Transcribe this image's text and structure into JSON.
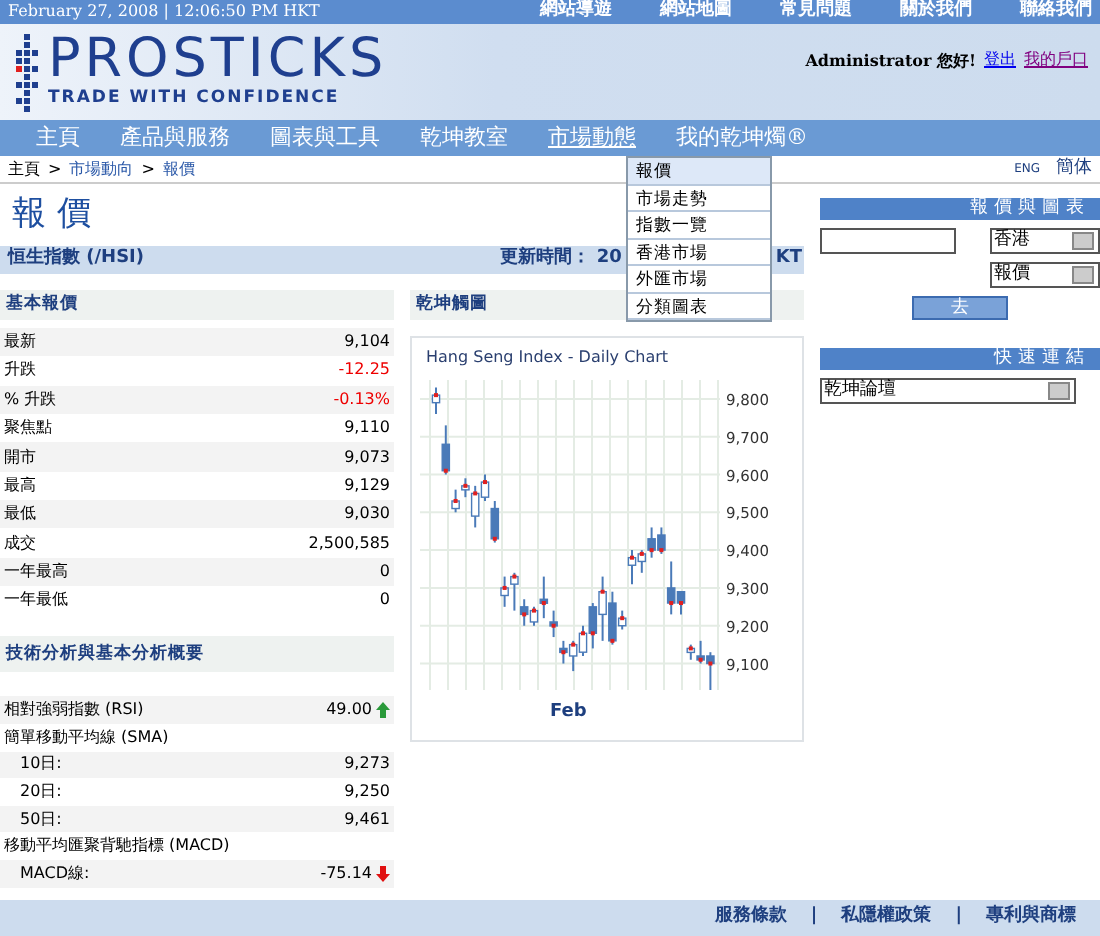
{
  "top_bar": {
    "date": "February 27, 2008 | 12:06:50 PM HKT",
    "links": [
      "網站導遊",
      "網站地圖",
      "常見問題",
      "關於我們",
      "聯絡我們"
    ]
  },
  "header": {
    "logo_title": "PROSTICKS",
    "logo_tagline": "TRADE WITH CONFIDENCE",
    "greeting": "Administrator 您好!",
    "user_links": [
      "登出",
      "我的戶口"
    ]
  },
  "nav": [
    {
      "label": "主頁",
      "selected": false
    },
    {
      "label": "產品與服務",
      "selected": false
    },
    {
      "label": "圖表與工具",
      "selected": false
    },
    {
      "label": "乾坤教室",
      "selected": false
    },
    {
      "label": "市場動態",
      "selected": true
    },
    {
      "label": "我的乾坤燭®",
      "selected": false
    }
  ],
  "dropdown_menu": [
    {
      "label": "報價",
      "selected": true
    },
    {
      "label": "市場走勢",
      "selected": false
    },
    {
      "label": "指數一覽",
      "selected": false
    },
    {
      "label": "香港市場",
      "selected": false
    },
    {
      "label": "外匯市場",
      "selected": false
    },
    {
      "label": "分類圖表",
      "selected": false
    }
  ],
  "breadcrumb": [
    {
      "kind": "link",
      "text": "主頁"
    },
    {
      "kind": "separator",
      "text": ">"
    },
    {
      "kind": "link",
      "text": "市場動向"
    },
    {
      "kind": "separator",
      "text": ">"
    },
    {
      "kind": "link",
      "text": "報價"
    }
  ],
  "languages": [
    {
      "label": "ENG",
      "selected": false
    },
    {
      "label": "簡体",
      "selected": false
    }
  ],
  "page_title": "報 價",
  "index_bar": {
    "name": "恒生指數 (/HSI)",
    "update_label": "更新時間： 20",
    "update_tail": "KT"
  },
  "basic_quote": {
    "heading": "基本報價",
    "rows": [
      {
        "label": "最新",
        "value": "9,104",
        "negative": false
      },
      {
        "label": "升跌",
        "value": "-12.25",
        "negative": true
      },
      {
        "label": "% 升跌",
        "value": "-0.13%",
        "negative": true
      },
      {
        "label": "聚焦點",
        "value": "9,110",
        "negative": false
      },
      {
        "label": "開市",
        "value": "9,073",
        "negative": false
      },
      {
        "label": "最高",
        "value": "9,129",
        "negative": false
      },
      {
        "label": "最低",
        "value": "9,030",
        "negative": false
      },
      {
        "label": "成交",
        "value": "2,500,585",
        "negative": false
      },
      {
        "label": "一年最高",
        "value": "0",
        "negative": false
      },
      {
        "label": "一年最低",
        "value": "0",
        "negative": false
      }
    ]
  },
  "chart_panel": {
    "heading": "乾坤觸圖",
    "chart_data": {
      "type": "candlestick",
      "title": "Hang Seng Index - Daily Chart",
      "xlabel": "Feb",
      "grid": true,
      "ylim": [
        9030,
        9850
      ],
      "yticks": [
        {
          "value": 9800,
          "label": "9,800"
        },
        {
          "value": 9700,
          "label": "9,700"
        },
        {
          "value": 9600,
          "label": "9,600"
        },
        {
          "value": 9500,
          "label": "9,500"
        },
        {
          "value": 9400,
          "label": "9,400"
        },
        {
          "value": 9300,
          "label": "9,300"
        },
        {
          "value": 9200,
          "label": "9,200"
        },
        {
          "value": 9100,
          "label": "9,100"
        }
      ],
      "ohlc": [
        [
          9790,
          9830,
          9760,
          9810
        ],
        [
          9680,
          9730,
          9600,
          9610
        ],
        [
          9510,
          9560,
          9500,
          9530
        ],
        [
          9560,
          9590,
          9540,
          9570
        ],
        [
          9490,
          9570,
          9460,
          9550
        ],
        [
          9540,
          9600,
          9530,
          9580
        ],
        [
          9510,
          9530,
          9420,
          9430
        ],
        [
          9280,
          9330,
          9250,
          9300
        ],
        [
          9310,
          9340,
          9240,
          9330
        ],
        [
          9250,
          9270,
          9200,
          9230
        ],
        [
          9210,
          9250,
          9200,
          9240
        ],
        [
          9270,
          9330,
          9220,
          9260
        ],
        [
          9210,
          9240,
          9170,
          9200
        ],
        [
          9140,
          9160,
          9100,
          9130
        ],
        [
          9120,
          9160,
          9080,
          9150
        ],
        [
          9130,
          9200,
          9120,
          9180
        ],
        [
          9250,
          9260,
          9140,
          9180
        ],
        [
          9230,
          9330,
          9160,
          9290
        ],
        [
          9260,
          9290,
          9150,
          9160
        ],
        [
          9200,
          9240,
          9190,
          9220
        ],
        [
          9360,
          9400,
          9310,
          9380
        ],
        [
          9370,
          9400,
          9340,
          9390
        ],
        [
          9430,
          9460,
          9380,
          9400
        ],
        [
          9440,
          9460,
          9390,
          9400
        ],
        [
          9300,
          9370,
          9230,
          9260
        ],
        [
          9290,
          9290,
          9230,
          9260
        ],
        [
          9130,
          9150,
          9110,
          9140
        ],
        [
          9120,
          9160,
          9100,
          9110
        ],
        [
          9120,
          9130,
          9030,
          9100
        ]
      ]
    }
  },
  "technical": {
    "heading": "技術分析與基本分析概要",
    "rows": [
      {
        "label": "相對強弱指數 (RSI)",
        "value": "49.00",
        "up_arrow": true
      },
      {
        "label": "簡單移動平均線 (SMA)",
        "children": [
          {
            "label": "10日:",
            "value": "9,273"
          },
          {
            "label": "20日:",
            "value": "9,250"
          },
          {
            "label": "50日:",
            "value": "9,461"
          }
        ]
      },
      {
        "label": "移動平均匯聚背馳指標 (MACD)",
        "children": [
          {
            "label": "MACD線:",
            "value": "-75.14",
            "up_arrow": false
          }
        ]
      }
    ]
  },
  "sidebar": {
    "quote_heading": "報價與圖表",
    "market_select": "香港",
    "type_select": "報價",
    "go_button": "去",
    "links_heading": "快速連結",
    "links_select": "乾坤論壇"
  },
  "footer_links": [
    {
      "kind": "link",
      "text": "服務條款"
    },
    {
      "kind": "separator",
      "text": "|"
    },
    {
      "kind": "link",
      "text": "私隱權政策"
    },
    {
      "kind": "separator",
      "text": "|"
    },
    {
      "kind": "link",
      "text": "專利與商標"
    }
  ]
}
